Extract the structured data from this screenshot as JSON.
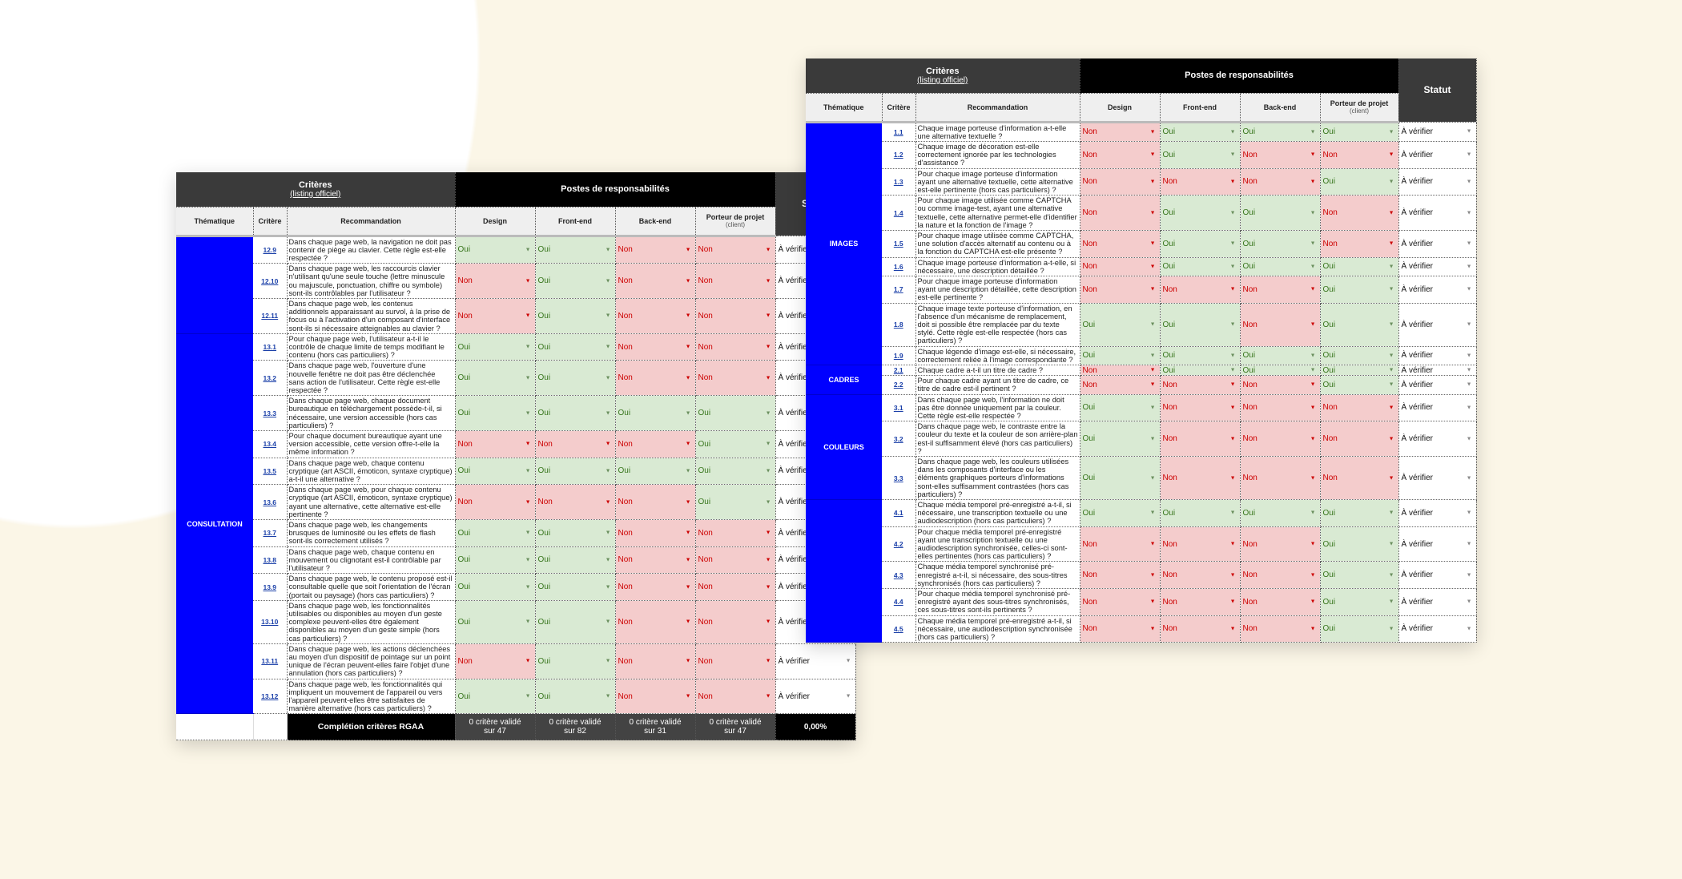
{
  "colors": {
    "theme": "#0000ff",
    "oui_bg": "#d9ead3",
    "oui_text": "#38761d",
    "non_bg": "#f4cccc",
    "non_text": "#cc0000",
    "header_dark": "#3a3a3a",
    "header_black": "#000000",
    "background": "#fbf6e7"
  },
  "headers": {
    "criteres": "Critères",
    "listing": "(listing officiel)",
    "postes": "Postes de responsabilités",
    "statut": "Statut",
    "thematique": "Thématique",
    "critere": "Critère",
    "recommandation": "Recommandation",
    "design": "Design",
    "frontend": "Front-end",
    "backend": "Back-end",
    "porteur": "Porteur de projet",
    "client": "(client)"
  },
  "left_sheet": {
    "groups": [
      {
        "theme": "",
        "rows": [
          {
            "id": "12.9",
            "text": "Dans chaque page web, la navigation ne doit pas contenir de piège au clavier. Cette règle est-elle respectée ?",
            "values": [
              "Oui",
              "Oui",
              "Non",
              "Non"
            ],
            "status": "À vérifier"
          },
          {
            "id": "12.10",
            "text": "Dans chaque page web, les raccourcis clavier n'utilisant qu'une seule touche (lettre minuscule ou majuscule, ponctuation, chiffre ou symbole) sont-ils contrôlables par l'utilisateur ?",
            "values": [
              "Non",
              "Oui",
              "Non",
              "Non"
            ],
            "status": "À vérifier"
          },
          {
            "id": "12.11",
            "text": "Dans chaque page web, les contenus additionnels apparaissant au survol, à la prise de focus ou à l'activation d'un composant d'interface sont-ils si nécessaire atteignables au clavier ?",
            "values": [
              "Non",
              "Oui",
              "Non",
              "Non"
            ],
            "status": "À vérifier"
          }
        ]
      },
      {
        "theme": "CONSULTATION",
        "rows": [
          {
            "id": "13.1",
            "text": "Pour chaque page web, l'utilisateur a-t-il le contrôle de chaque limite de temps modifiant le contenu (hors cas particuliers) ?",
            "values": [
              "Oui",
              "Oui",
              "Non",
              "Non"
            ],
            "status": "À vérifier"
          },
          {
            "id": "13.2",
            "text": "Dans chaque page web, l'ouverture d'une nouvelle fenêtre ne doit pas être déclenchée sans action de l'utilisateur. Cette règle est-elle respectée ?",
            "values": [
              "Oui",
              "Oui",
              "Non",
              "Non"
            ],
            "status": "À vérifier"
          },
          {
            "id": "13.3",
            "text": "Dans chaque page web, chaque document bureautique en téléchargement possède-t-il, si nécessaire, une version accessible (hors cas particuliers) ?",
            "values": [
              "Oui",
              "Oui",
              "Oui",
              "Oui"
            ],
            "status": "À vérifier"
          },
          {
            "id": "13.4",
            "text": "Pour chaque document bureautique ayant une version accessible, cette version offre-t-elle la même information ?",
            "values": [
              "Non",
              "Non",
              "Non",
              "Oui"
            ],
            "status": "À vérifier"
          },
          {
            "id": "13.5",
            "text": "Dans chaque page web, chaque contenu cryptique (art ASCII, émoticon, syntaxe cryptique) a-t-il une alternative ?",
            "values": [
              "Oui",
              "Oui",
              "Oui",
              "Oui"
            ],
            "status": "À vérifier"
          },
          {
            "id": "13.6",
            "text": "Dans chaque page web, pour chaque contenu cryptique (art ASCII, émoticon, syntaxe cryptique) ayant une alternative, cette alternative est-elle pertinente ?",
            "values": [
              "Non",
              "Non",
              "Non",
              "Oui"
            ],
            "status": "À vérifier"
          },
          {
            "id": "13.7",
            "text": "Dans chaque page web, les changements brusques de luminosité ou les effets de flash sont-ils correctement utilisés ?",
            "values": [
              "Oui",
              "Oui",
              "Non",
              "Non"
            ],
            "status": "À vérifier"
          },
          {
            "id": "13.8",
            "text": "Dans chaque page web, chaque contenu en mouvement ou clignotant est-il contrôlable par l'utilisateur ?",
            "values": [
              "Oui",
              "Oui",
              "Non",
              "Non"
            ],
            "status": "À vérifier"
          },
          {
            "id": "13.9",
            "text": "Dans chaque page web, le contenu proposé est-il consultable quelle que soit l'orientation de l'écran (portait ou paysage) (hors cas particuliers) ?",
            "values": [
              "Oui",
              "Oui",
              "Non",
              "Non"
            ],
            "status": "À vérifier"
          },
          {
            "id": "13.10",
            "text": "Dans chaque page web, les fonctionnalités utilisables ou disponibles au moyen d'un geste complexe peuvent-elles être également disponibles au moyen d'un geste simple (hors cas particuliers) ?",
            "values": [
              "Oui",
              "Oui",
              "Non",
              "Non"
            ],
            "status": "À vérifier"
          },
          {
            "id": "13.11",
            "text": "Dans chaque page web, les actions déclenchées au moyen d'un dispositif de pointage sur un point unique de l'écran peuvent-elles faire l'objet d'une annulation (hors cas particuliers) ?",
            "values": [
              "Non",
              "Oui",
              "Non",
              "Non"
            ],
            "status": "À vérifier"
          },
          {
            "id": "13.12",
            "text": "Dans chaque page web, les fonctionnalités qui impliquent un mouvement de l'appareil ou vers l'appareil peuvent-elles être satisfaites de manière alternative (hors cas particuliers) ?",
            "values": [
              "Oui",
              "Oui",
              "Non",
              "Non"
            ],
            "status": "À vérifier"
          }
        ]
      }
    ],
    "footer": {
      "label": "Complétion critères RGAA",
      "counts": [
        [
          "0 critère validé",
          "sur 47"
        ],
        [
          "0 critère validé",
          "sur 82"
        ],
        [
          "0 critère validé",
          "sur 31"
        ],
        [
          "0 critère validé",
          "sur 47"
        ]
      ],
      "percent": "0,00%"
    }
  },
  "right_sheet": {
    "groups": [
      {
        "theme": "IMAGES",
        "rows": [
          {
            "id": "1.1",
            "text": "Chaque image porteuse d'information a-t-elle une alternative textuelle ?",
            "values": [
              "Non",
              "Oui",
              "Oui",
              "Oui"
            ],
            "status": "À vérifier"
          },
          {
            "id": "1.2",
            "text": "Chaque image de décoration est-elle correctement ignorée par les technologies d'assistance ?",
            "values": [
              "Non",
              "Oui",
              "Non",
              "Non"
            ],
            "status": "À vérifier"
          },
          {
            "id": "1.3",
            "text": "Pour chaque image porteuse d'information ayant une alternative textuelle, cette alternative est-elle pertinente (hors cas particuliers) ?",
            "values": [
              "Non",
              "Non",
              "Non",
              "Oui"
            ],
            "status": "À vérifier"
          },
          {
            "id": "1.4",
            "text": "Pour chaque image utilisée comme CAPTCHA ou comme image-test, ayant une alternative textuelle, cette alternative permet-elle d'identifier la nature et la fonction de l'image ?",
            "values": [
              "Non",
              "Oui",
              "Oui",
              "Non"
            ],
            "status": "À vérifier"
          },
          {
            "id": "1.5",
            "text": "Pour chaque image utilisée comme CAPTCHA, une solution d'accès alternatif au contenu ou à la fonction du CAPTCHA est-elle présente ?",
            "values": [
              "Non",
              "Oui",
              "Oui",
              "Non"
            ],
            "status": "À vérifier"
          },
          {
            "id": "1.6",
            "text": "Chaque image porteuse d'information a-t-elle, si nécessaire, une description détaillée ?",
            "values": [
              "Non",
              "Oui",
              "Oui",
              "Oui"
            ],
            "status": "À vérifier"
          },
          {
            "id": "1.7",
            "text": "Pour chaque image porteuse d'information ayant une description détaillée, cette description est-elle pertinente ?",
            "values": [
              "Non",
              "Non",
              "Non",
              "Oui"
            ],
            "status": "À vérifier"
          },
          {
            "id": "1.8",
            "text": "Chaque image texte porteuse d'information, en l'absence d'un mécanisme de remplacement, doit si possible être remplacée par du texte stylé. Cette règle est-elle respectée (hors cas particuliers) ?",
            "values": [
              "Oui",
              "Oui",
              "Non",
              "Oui"
            ],
            "status": "À vérifier"
          },
          {
            "id": "1.9",
            "text": "Chaque légende d'image est-elle, si nécessaire, correctement reliée à l'image correspondante ?",
            "values": [
              "Oui",
              "Oui",
              "Oui",
              "Oui"
            ],
            "status": "À vérifier"
          }
        ]
      },
      {
        "theme": "CADRES",
        "rows": [
          {
            "id": "2.1",
            "text": "Chaque cadre a-t-il un titre de cadre ?",
            "values": [
              "Non",
              "Oui",
              "Oui",
              "Oui"
            ],
            "status": "À vérifier"
          },
          {
            "id": "2.2",
            "text": "Pour chaque cadre ayant un titre de cadre, ce titre de cadre est-il pertinent ?",
            "values": [
              "Non",
              "Non",
              "Non",
              "Oui"
            ],
            "status": "À vérifier"
          }
        ]
      },
      {
        "theme": "COULEURS",
        "rows": [
          {
            "id": "3.1",
            "text": "Dans chaque page web, l'information ne doit pas être donnée uniquement par la couleur. Cette règle est-elle respectée ?",
            "values": [
              "Oui",
              "Non",
              "Non",
              "Non"
            ],
            "status": "À vérifier"
          },
          {
            "id": "3.2",
            "text": "Dans chaque page web, le contraste entre la couleur du texte et la couleur de son arrière-plan est-il suffisamment élevé (hors cas particuliers) ?",
            "values": [
              "Oui",
              "Non",
              "Non",
              "Non"
            ],
            "status": "À vérifier"
          },
          {
            "id": "3.3",
            "text": "Dans chaque page web, les couleurs utilisées dans les composants d'interface ou les éléments graphiques porteurs d'informations sont-elles suffisamment contrastées (hors cas particuliers) ?",
            "values": [
              "Oui",
              "Non",
              "Non",
              "Non"
            ],
            "status": "À vérifier"
          }
        ]
      },
      {
        "theme": "",
        "rows": [
          {
            "id": "4.1",
            "text": "Chaque média temporel pré-enregistré a-t-il, si nécessaire, une transcription textuelle ou une audiodescription (hors cas particuliers) ?",
            "values": [
              "Oui",
              "Oui",
              "Oui",
              "Oui"
            ],
            "status": "À vérifier"
          },
          {
            "id": "4.2",
            "text": "Pour chaque média temporel pré-enregistré ayant une transcription textuelle ou une audiodescription synchronisée, celles-ci sont-elles pertinentes (hors cas particuliers) ?",
            "values": [
              "Non",
              "Non",
              "Non",
              "Oui"
            ],
            "status": "À vérifier"
          },
          {
            "id": "4.3",
            "text": "Chaque média temporel synchronisé pré-enregistré a-t-il, si nécessaire, des sous-titres synchronisés (hors cas particuliers) ?",
            "values": [
              "Non",
              "Non",
              "Non",
              "Oui"
            ],
            "status": "À vérifier"
          },
          {
            "id": "4.4",
            "text": "Pour chaque média temporel synchronisé pré-enregistré ayant des sous-titres synchronisés, ces sous-titres sont-ils pertinents ?",
            "values": [
              "Non",
              "Non",
              "Non",
              "Oui"
            ],
            "status": "À vérifier"
          },
          {
            "id": "4.5",
            "text": "Chaque média temporel pré-enregistré a-t-il, si nécessaire, une audiodescription synchronisée (hors cas particuliers) ?",
            "values": [
              "Non",
              "Non",
              "Non",
              "Oui"
            ],
            "status": "À vérifier"
          }
        ]
      }
    ]
  }
}
